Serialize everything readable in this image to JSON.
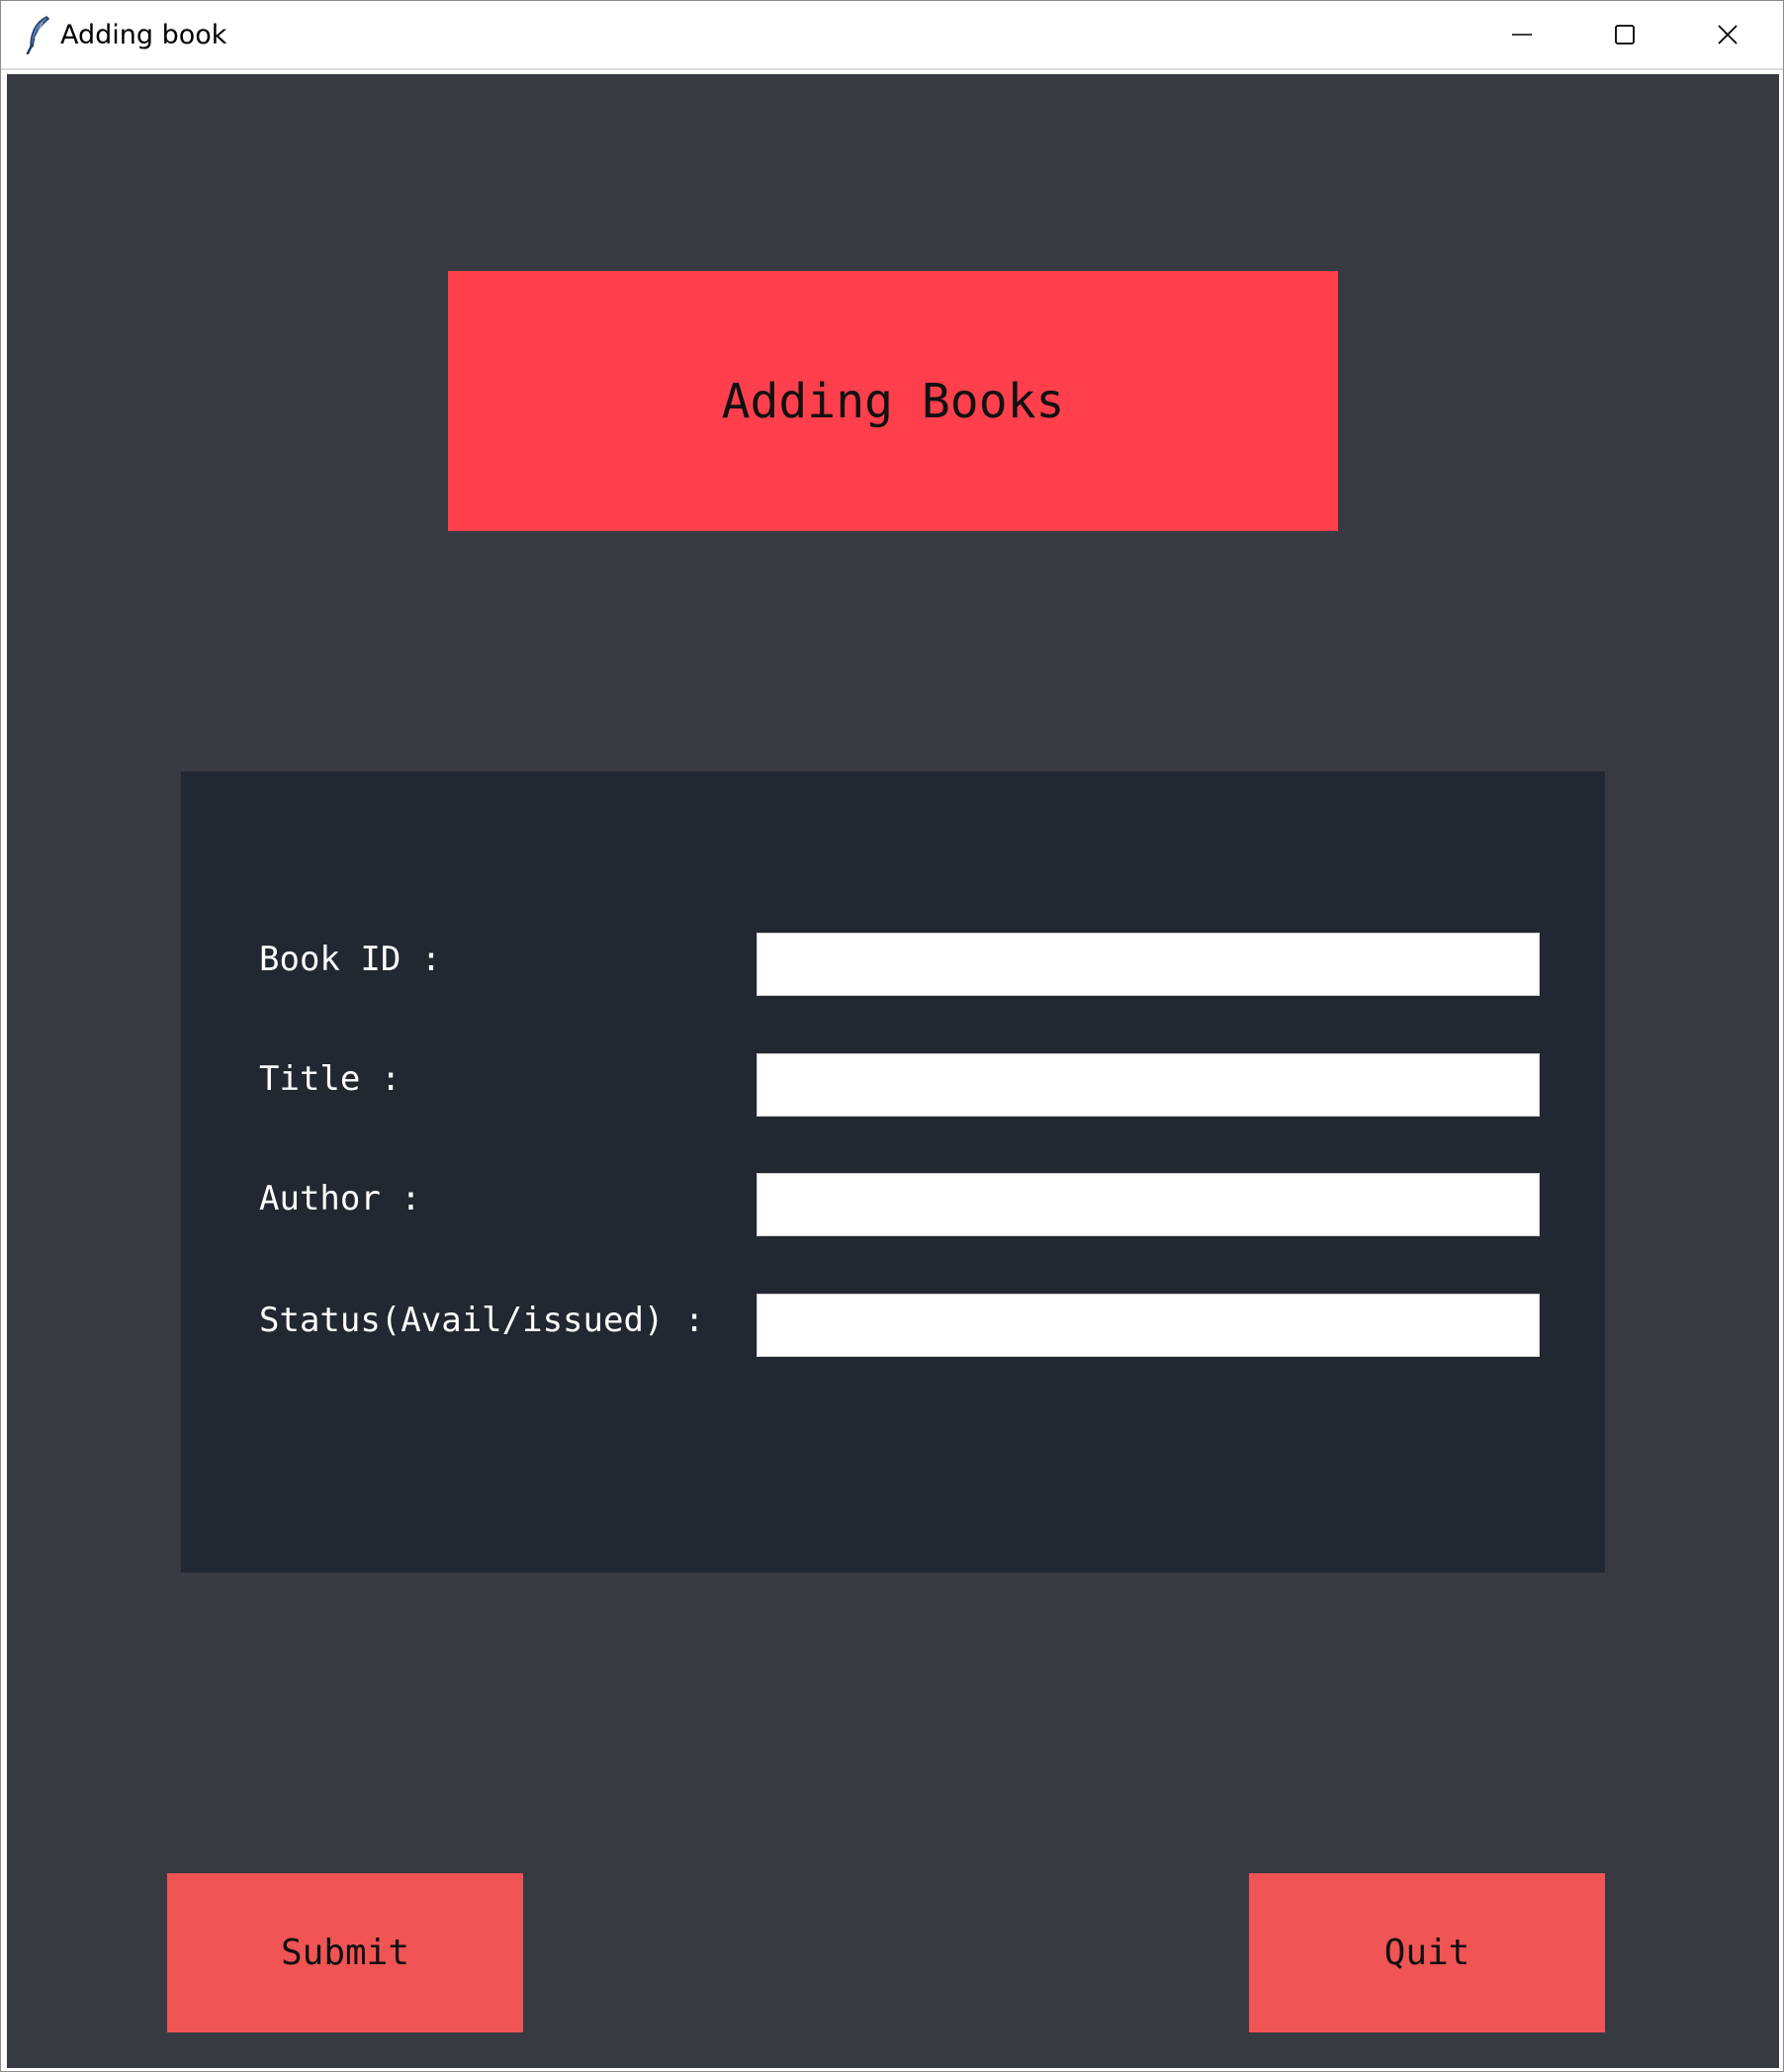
{
  "window": {
    "title": "Adding book",
    "icon": "feather-icon",
    "controls": [
      "minimize-icon",
      "maximize-icon",
      "close-icon"
    ]
  },
  "heading": {
    "text": "Adding Books",
    "color": "#ff404c"
  },
  "form": {
    "fields": [
      {
        "label": "Book ID :",
        "value": ""
      },
      {
        "label": "Title :",
        "value": ""
      },
      {
        "label": "Author :",
        "value": ""
      },
      {
        "label": "Status(Avail/issued) :",
        "value": ""
      }
    ]
  },
  "actions": {
    "submit_label": "Submit",
    "quit_label": "Quit",
    "color": "#f05454"
  },
  "theme": {
    "background": "#383a42",
    "panel": "#222831"
  }
}
